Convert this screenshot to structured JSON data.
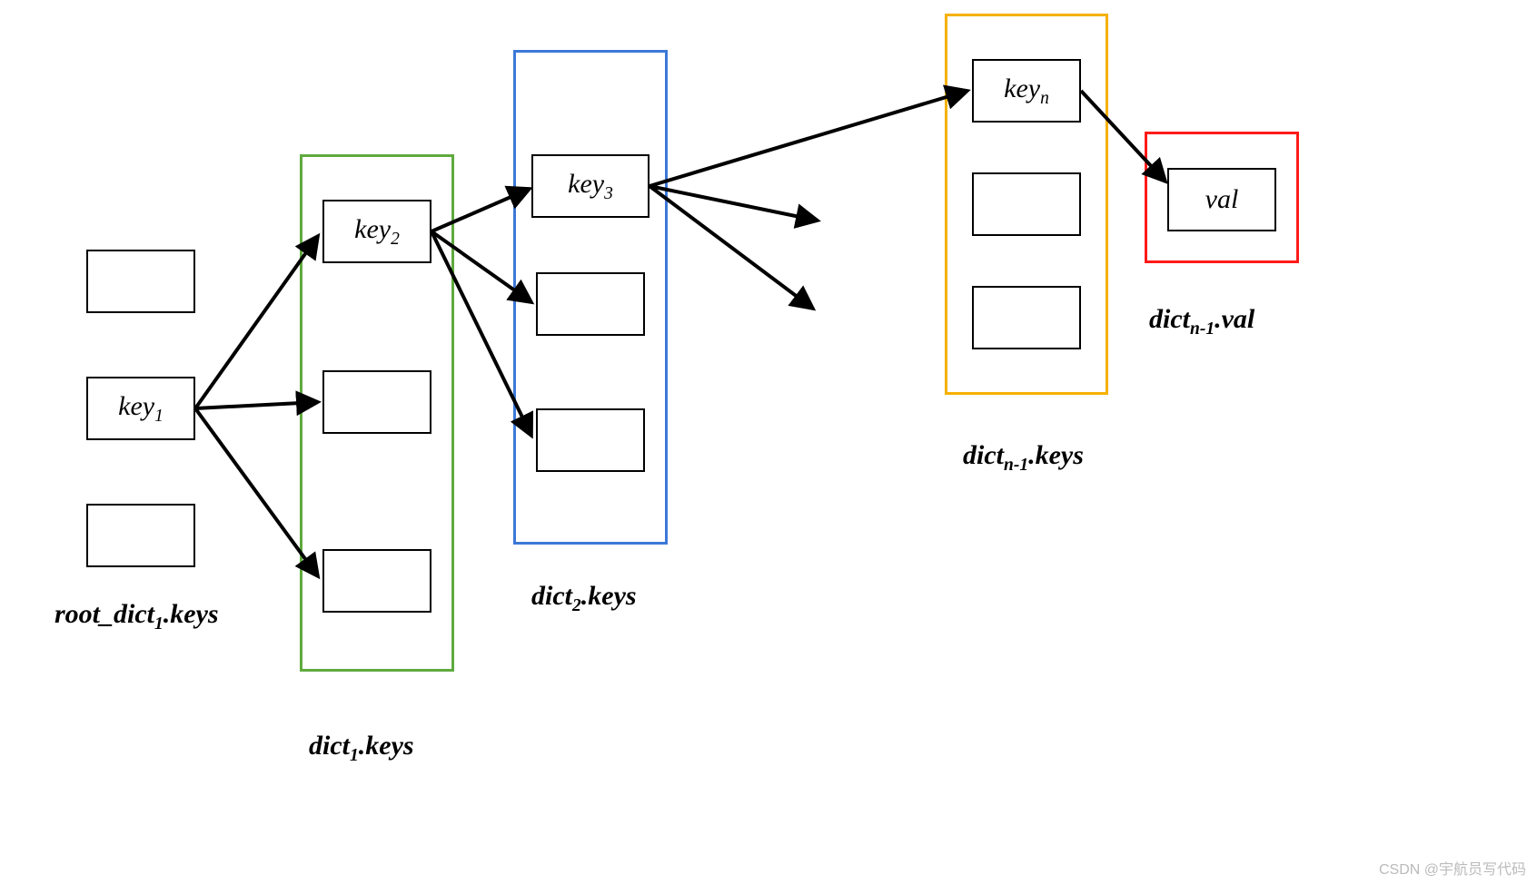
{
  "columns": {
    "col1": {
      "label": "root_dict₁.keys",
      "boxes": [
        "",
        "key₁",
        ""
      ]
    },
    "col2": {
      "label": "dict₁.keys",
      "groupColor": "#5faa3f",
      "boxes": [
        "key₂",
        "",
        ""
      ]
    },
    "col3": {
      "label": "dict₂.keys",
      "groupColor": "#3c78d8",
      "boxes": [
        "key₃",
        "",
        ""
      ]
    },
    "col4": {
      "label": "dictₙ₋₁.keys",
      "groupColor": "#f6b100",
      "boxes": [
        "keyₙ",
        "",
        ""
      ]
    },
    "col5": {
      "label": "dictₙ₋₁.val",
      "groupColor": "#ff1a1a",
      "boxes": [
        "val"
      ]
    }
  },
  "watermark": "CSDN @宇航员写代码"
}
